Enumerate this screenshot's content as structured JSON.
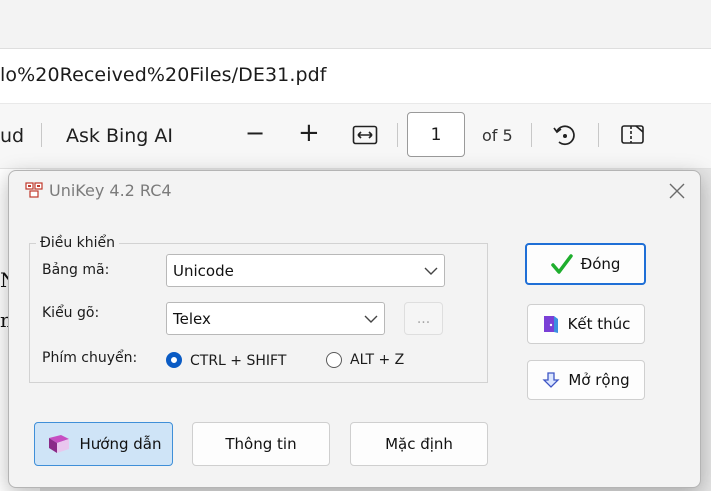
{
  "browser": {
    "url_text": "lo%20Received%20Files/DE31.pdf",
    "toolbar": {
      "cloud_label": "ud",
      "ask_label": "Ask Bing AI",
      "zoom_out_label": "−",
      "zoom_in_label": "+",
      "page_current": "1",
      "page_total_label": "of 5"
    },
    "doc_glyphs": [
      "N",
      "m"
    ]
  },
  "dialog": {
    "title": "UniKey 4.2 RC4",
    "group_label": "Điều khiển",
    "charset_label": "Bảng mã:",
    "charset_value": "Unicode",
    "input_method_label": "Kiểu gõ:",
    "input_method_value": "Telex",
    "more_label": "...",
    "switch_label": "Phím chuyển:",
    "switch_options": [
      {
        "label": "CTRL + SHIFT",
        "selected": true
      },
      {
        "label": "ALT + Z",
        "selected": false
      }
    ],
    "buttons": {
      "close": "Đóng",
      "exit": "Kết thúc",
      "expand": "Mở rộng",
      "help": "Hướng dẫn",
      "info": "Thông tin",
      "default": "Mặc định"
    }
  },
  "colors": {
    "accent": "#1f6fd6",
    "check_green": "#1fae2e",
    "radio_blue": "#0a5bc4"
  }
}
